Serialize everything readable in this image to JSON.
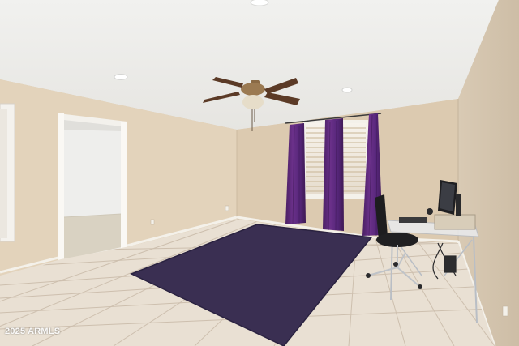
{
  "watermark": {
    "text": "2025 ARMLS"
  },
  "colors": {
    "ceiling": "#eeeeec",
    "wall_left": "#e3d3bb",
    "wall_back": "#dccab0",
    "wall_right": "#d5c6b1",
    "floor_tile": "#e9e0d3",
    "grout": "#cdbfae",
    "rug": "#3a2f52",
    "curtain": "#5e2b7a",
    "baseboard": "#f4f1ea"
  },
  "icons": [
    "ceiling-fan",
    "recessed-light",
    "window-shutters",
    "curtain",
    "rug",
    "desk",
    "office-chair",
    "computer-monitor",
    "doorway"
  ]
}
